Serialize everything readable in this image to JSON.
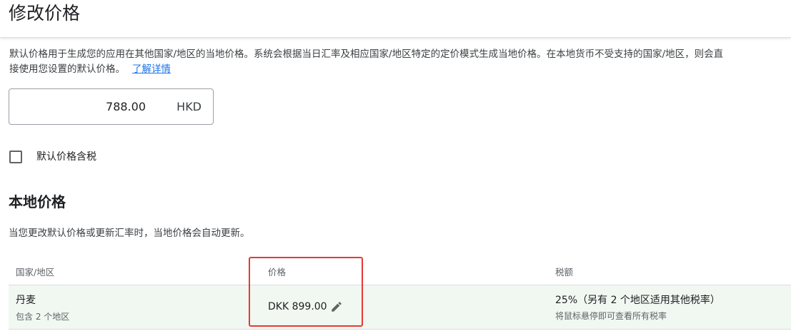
{
  "header": {
    "title": "修改价格"
  },
  "default_price": {
    "description": "默认价格用于生成您的应用在其他国家/地区的当地价格。系统会根据当日汇率及相应国家/地区特定的定价模式生成当地价格。在本地货币不受支持的国家/地区，则会直接使用您设置的默认价格。",
    "learn_more": "了解详情",
    "value": "788.00",
    "currency": "HKD",
    "tax_included_label": "默认价格含税",
    "tax_included_checked": false
  },
  "local_prices": {
    "title": "本地价格",
    "description": "当您更改默认价格或更新汇率时，当地价格会自动更新。",
    "columns": {
      "country": "国家/地区",
      "price": "价格",
      "tax": "税额"
    },
    "rows": [
      {
        "country": "丹麦",
        "country_sub": "包含 2 个地区",
        "price": "DKK 899.00",
        "tax": "25%（另有 2 个地区适用其他税率）",
        "tax_sub": "将鼠标悬停即可查看所有税率"
      }
    ]
  },
  "colors": {
    "link": "#1a73e8",
    "row_highlight": "#f1f8f1",
    "annotation_box": "#e53935"
  },
  "icons": {
    "edit": "pencil-icon"
  }
}
